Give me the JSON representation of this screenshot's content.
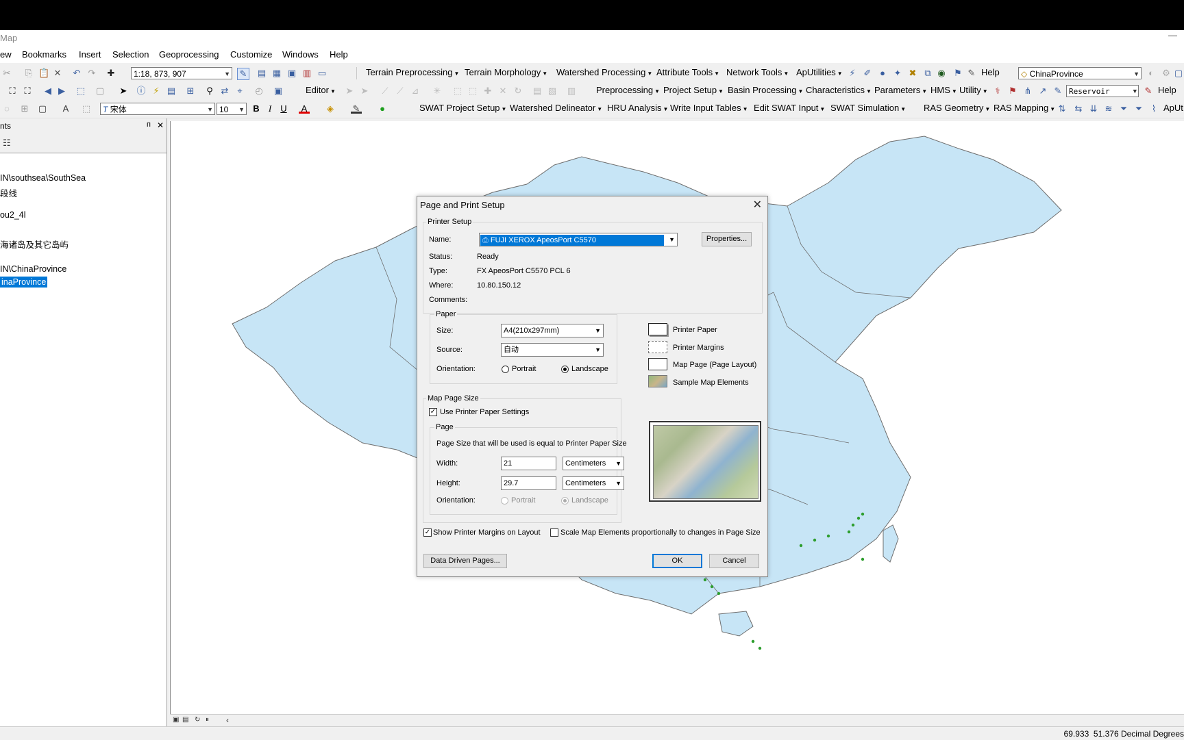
{
  "window": {
    "title": "Map",
    "minimize": "—"
  },
  "menu": [
    "ew",
    "Bookmarks",
    "Insert",
    "Selection",
    "Geoprocessing",
    "Customize",
    "Windows",
    "Help"
  ],
  "toolbar1": {
    "scale": "1:18, 873, 907",
    "items": [
      "Terrain Preprocessing",
      "Terrain Morphology",
      "Watershed Processing",
      "Attribute Tools",
      "Network Tools",
      "ApUtilities"
    ],
    "help": "Help",
    "layer_combo": "ChinaProvince"
  },
  "toolbar2": {
    "editor": "Editor",
    "items": [
      "Preprocessing",
      "Project Setup",
      "Basin Processing",
      "Characteristics",
      "Parameters",
      "HMS",
      "Utility"
    ],
    "reservoir_combo": "Reservoir",
    "help": "Help"
  },
  "toolbar3": {
    "font": "宋体",
    "font_size": "10",
    "bold": "B",
    "italic": "I",
    "underline": "U",
    "items": [
      "SWAT Project Setup",
      "Watershed Delineator",
      "HRU Analysis",
      "Write Input Tables",
      "Edit SWAT Input",
      "SWAT Simulation",
      "RAS Geometry",
      "RAS Mapping"
    ],
    "apu": "ApUt"
  },
  "toc": {
    "header": "nts",
    "pin": "ᴨ",
    "close": "✕",
    "items": [
      "IN\\southsea\\SouthSea",
      "段线",
      "ou2_4l",
      "海诸岛及其它岛屿",
      "IN\\ChinaProvince",
      "inaProvince"
    ]
  },
  "status": {
    "coords": "69.933  51.376 Decimal Degrees"
  },
  "dialog": {
    "title": "Page and Print Setup",
    "close": "✕",
    "printer_setup": {
      "group": "Printer Setup",
      "name_label": "Name:",
      "name_value": "FUJI XEROX ApeosPort C5570",
      "properties_button": "Properties...",
      "status_label": "Status:",
      "status_value": "Ready",
      "type_label": "Type:",
      "type_value": "FX ApeosPort C5570 PCL 6",
      "where_label": "Where:",
      "where_value": "10.80.150.12",
      "comments_label": "Comments:"
    },
    "paper": {
      "group": "Paper",
      "size_label": "Size:",
      "size_value": "A4(210x297mm)",
      "source_label": "Source:",
      "source_value": "自动",
      "orientation_label": "Orientation:",
      "portrait": "Portrait",
      "landscape": "Landscape",
      "selected": "Landscape"
    },
    "legend": {
      "printer_paper": "Printer Paper",
      "printer_margins": "Printer Margins",
      "map_page": "Map Page (Page Layout)",
      "sample_elements": "Sample Map Elements"
    },
    "map_page_size": {
      "group": "Map Page Size",
      "use_printer_settings": "Use Printer Paper Settings",
      "use_printer_settings_checked": true,
      "page_group": "Page",
      "page_note": "Page Size that will be used is equal to Printer Paper Size",
      "width_label": "Width:",
      "width_value": "21",
      "width_unit": "Centimeters",
      "height_label": "Height:",
      "height_value": "29.7",
      "height_unit": "Centimeters",
      "orientation_label": "Orientation:",
      "portrait": "Portrait",
      "landscape": "Landscape"
    },
    "show_margins": "Show Printer Margins on Layout",
    "show_margins_checked": true,
    "scale_elements": "Scale Map Elements proportionally to changes in Page Size",
    "scale_elements_checked": false,
    "data_driven_button": "Data Driven Pages...",
    "ok_button": "OK",
    "cancel_button": "Cancel"
  },
  "colors": {
    "map_fill": "#c7e5f6",
    "map_stroke": "#6e6e6e",
    "selection": "#0078d7",
    "island_green": "#2e9e2e"
  }
}
